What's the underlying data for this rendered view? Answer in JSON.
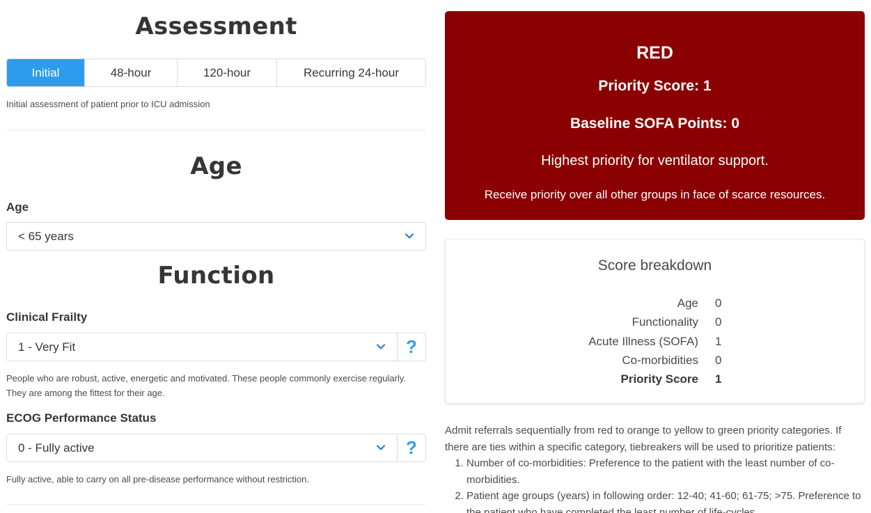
{
  "assessment": {
    "title": "Assessment",
    "tabs": [
      {
        "label": "Initial",
        "active": true
      },
      {
        "label": "48-hour",
        "active": false
      },
      {
        "label": "120-hour",
        "active": false
      },
      {
        "label": "Recurring 24-hour",
        "active": false
      }
    ],
    "help": "Initial assessment of patient prior to ICU admission"
  },
  "age_section": {
    "title": "Age",
    "field_label": "Age",
    "selected": "< 65 years"
  },
  "function_section": {
    "title": "Function",
    "frailty": {
      "label": "Clinical Frailty",
      "selected": "1 - Very Fit",
      "help_button": "?",
      "help_line1": "People who are robust, active, energetic and motivated. These people commonly exercise regularly.",
      "help_line2": "They are among the fittest for their age."
    },
    "ecog": {
      "label": "ECOG Performance Status",
      "selected": "0 - Fully active",
      "help_button": "?",
      "help": "Fully active, able to carry on all pre-disease performance without restriction."
    }
  },
  "result": {
    "color_name": "RED",
    "bg_color": "#8b0000",
    "priority_score": "Priority Score: 1",
    "baseline_sofa": "Baseline SOFA Points: 0",
    "message1": "Highest priority for ventilator support.",
    "message2": "Receive priority over all other groups in face of scarce resources."
  },
  "breakdown": {
    "title": "Score breakdown",
    "rows": [
      {
        "label": "Age",
        "value": "0"
      },
      {
        "label": "Functionality",
        "value": "0"
      },
      {
        "label": "Acute Illness (SOFA)",
        "value": "1"
      },
      {
        "label": "Co-morbidities",
        "value": "0"
      }
    ],
    "total": {
      "label": "Priority Score",
      "value": "1"
    }
  },
  "instructions": {
    "intro": "Admit referrals sequentially from red to orange to yellow to green priority categories. If there are ties within a specific category, tiebreakers will be used to prioritize patients:",
    "items": [
      "Number of co-morbidities: Preference to the patient with the least number of co-morbidities.",
      "Patient age groups (years) in following order: 12-40; 41-60; 61-75; >75. Preference to the patient who have completed the least number of life-cycles."
    ]
  },
  "colors": {
    "accent": "#2d9ced",
    "border": "#dbdbdb",
    "text": "#363636"
  }
}
